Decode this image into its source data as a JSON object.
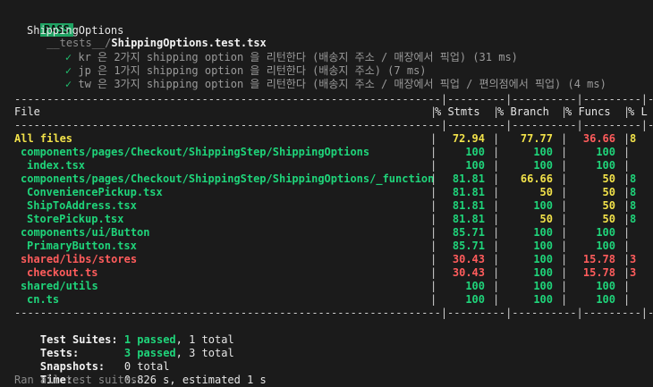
{
  "header": {
    "badge": "PASS",
    "path_prefix": "__tests__/",
    "file_name": "ShippingOptions.test.tsx"
  },
  "suite": {
    "name": "ShippingOptions",
    "tests": [
      {
        "check": "✓",
        "text": "kr 은 2가지 shipping option 을 리턴한다 (배송지 주소 / 매장에서 픽업) (31 ms)"
      },
      {
        "check": "✓",
        "text": "jp 은 1가지 shipping option 을 리턴한다 (배송지 주소) (7 ms)"
      },
      {
        "check": "✓",
        "text": "tw 은 3가지 shipping option 을 리턴한다 (배송지 주소 / 매장에서 픽업 / 편의점에서 픽업) (4 ms)"
      }
    ]
  },
  "coverage": {
    "columns": [
      "File",
      "% Stmts",
      "% Branch",
      "% Funcs",
      "% L"
    ],
    "rows": [
      {
        "file": "All files",
        "indent": 0,
        "color": "yellow",
        "stmts": "72.94",
        "stmts_c": "yellow",
        "branch": "77.77",
        "branch_c": "yellow",
        "funcs": "36.66",
        "funcs_c": "red",
        "lines": "8",
        "lines_c": "yellow"
      },
      {
        "file": "components/pages/Checkout/ShippingStep/ShippingOptions",
        "indent": 1,
        "color": "green",
        "stmts": "100",
        "stmts_c": "green",
        "branch": "100",
        "branch_c": "green",
        "funcs": "100",
        "funcs_c": "green",
        "lines": "",
        "lines_c": "green"
      },
      {
        "file": "index.tsx",
        "indent": 2,
        "color": "green",
        "stmts": "100",
        "stmts_c": "green",
        "branch": "100",
        "branch_c": "green",
        "funcs": "100",
        "funcs_c": "green",
        "lines": "",
        "lines_c": "green"
      },
      {
        "file": "components/pages/Checkout/ShippingStep/ShippingOptions/_function",
        "indent": 1,
        "color": "green",
        "stmts": "81.81",
        "stmts_c": "green",
        "branch": "66.66",
        "branch_c": "yellow",
        "funcs": "50",
        "funcs_c": "yellow",
        "lines": "8",
        "lines_c": "green"
      },
      {
        "file": "ConveniencePickup.tsx",
        "indent": 2,
        "color": "green",
        "stmts": "81.81",
        "stmts_c": "green",
        "branch": "50",
        "branch_c": "yellow",
        "funcs": "50",
        "funcs_c": "yellow",
        "lines": "8",
        "lines_c": "green"
      },
      {
        "file": "ShipToAddress.tsx",
        "indent": 2,
        "color": "green",
        "stmts": "81.81",
        "stmts_c": "green",
        "branch": "100",
        "branch_c": "green",
        "funcs": "50",
        "funcs_c": "yellow",
        "lines": "8",
        "lines_c": "green"
      },
      {
        "file": "StorePickup.tsx",
        "indent": 2,
        "color": "green",
        "stmts": "81.81",
        "stmts_c": "green",
        "branch": "50",
        "branch_c": "yellow",
        "funcs": "50",
        "funcs_c": "yellow",
        "lines": "8",
        "lines_c": "green"
      },
      {
        "file": "components/ui/Button",
        "indent": 1,
        "color": "green",
        "stmts": "85.71",
        "stmts_c": "green",
        "branch": "100",
        "branch_c": "green",
        "funcs": "100",
        "funcs_c": "green",
        "lines": "",
        "lines_c": "green"
      },
      {
        "file": "PrimaryButton.tsx",
        "indent": 2,
        "color": "green",
        "stmts": "85.71",
        "stmts_c": "green",
        "branch": "100",
        "branch_c": "green",
        "funcs": "100",
        "funcs_c": "green",
        "lines": "",
        "lines_c": "green"
      },
      {
        "file": "shared/libs/stores",
        "indent": 1,
        "color": "red",
        "stmts": "30.43",
        "stmts_c": "red",
        "branch": "100",
        "branch_c": "green",
        "funcs": "15.78",
        "funcs_c": "red",
        "lines": "3",
        "lines_c": "red"
      },
      {
        "file": "checkout.ts",
        "indent": 2,
        "color": "red",
        "stmts": "30.43",
        "stmts_c": "red",
        "branch": "100",
        "branch_c": "green",
        "funcs": "15.78",
        "funcs_c": "red",
        "lines": "3",
        "lines_c": "red"
      },
      {
        "file": "shared/utils",
        "indent": 1,
        "color": "green",
        "stmts": "100",
        "stmts_c": "green",
        "branch": "100",
        "branch_c": "green",
        "funcs": "100",
        "funcs_c": "green",
        "lines": "",
        "lines_c": "green"
      },
      {
        "file": "cn.ts",
        "indent": 2,
        "color": "green",
        "stmts": "100",
        "stmts_c": "green",
        "branch": "100",
        "branch_c": "green",
        "funcs": "100",
        "funcs_c": "green",
        "lines": "",
        "lines_c": "green"
      }
    ]
  },
  "summary": {
    "suites_label": "Test Suites:",
    "suites_passed": "1 passed",
    "suites_total": ", 1 total",
    "tests_label": "Tests:",
    "tests_passed": "3 passed",
    "tests_total": ", 3 total",
    "snapshots_label": "Snapshots:",
    "snapshots_value": "0 total",
    "time_label": "Time:",
    "time_value": "0.826 s, estimated 1 s",
    "footer": "Ran all test suites."
  }
}
